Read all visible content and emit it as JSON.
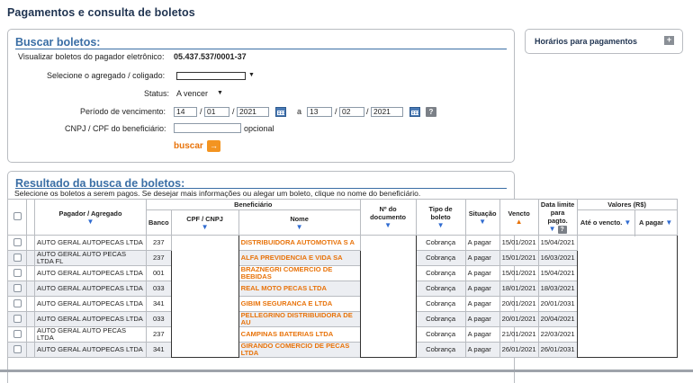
{
  "page": {
    "title": "Pagamentos e consulta de boletos"
  },
  "search": {
    "heading": "Buscar boletos:",
    "payer_label": "Visualizar boletos do pagador eletrônico:",
    "payer_value": "05.437.537/0001-37",
    "aggregate_label": "Selecione o agregado / coligado:",
    "status_label": "Status:",
    "status_value": "A vencer",
    "period_label": "Período de vencimento:",
    "from": {
      "day": "14",
      "month": "01",
      "year": "2021"
    },
    "to_label": "a",
    "to": {
      "day": "13",
      "month": "02",
      "year": "2021"
    },
    "help": "?",
    "cnpj_label": "CNPJ / CPF do beneficiário:",
    "cnpj_value": "",
    "optional_label": "opcional",
    "submit_label": "buscar",
    "submit_icon": "→"
  },
  "side": {
    "title": "Horários para pagamentos",
    "expand": "+"
  },
  "results": {
    "heading": "Resultado da busca de boletos:",
    "instruction": "Selecione os boletos a serem pagos. Se desejar mais informações ou alegar um boleto, clique no nome do beneficiário.",
    "headers": {
      "payer": "Pagador / Agregado",
      "beneficiary": "Beneficiário",
      "bank": "Banco",
      "cpf": "CPF / CNPJ",
      "name": "Nome",
      "doc": "Nº do documento",
      "type": "Tipo de boleto",
      "status": "Situação",
      "due": "Vencto",
      "limit": "Data limite para pagto.",
      "values": "Valores (R$)",
      "until_due": "Até o vencto.",
      "to_pay": "A pagar"
    },
    "rows": [
      {
        "payer": "AUTO GERAL AUTOPECAS LTDA",
        "bank": "237",
        "name": "DISTRIBUIDORA AUTOMOTIVA S A",
        "type": "Cobrança",
        "status": "A pagar",
        "due": "15/01/2021",
        "limit": "15/04/2021"
      },
      {
        "payer": "AUTO GERAL AUTO PECAS LTDA FL",
        "bank": "237",
        "name": "ALFA PREVIDENCIA E VIDA SA",
        "type": "Cobrança",
        "status": "A pagar",
        "due": "15/01/2021",
        "limit": "16/03/2021"
      },
      {
        "payer": "AUTO GERAL AUTOPECAS LTDA",
        "bank": "001",
        "name": "BRAZNEGRI COMERCIO DE BEBIDAS",
        "type": "Cobrança",
        "status": "A pagar",
        "due": "15/01/2021",
        "limit": "15/04/2021"
      },
      {
        "payer": "AUTO GERAL AUTOPECAS LTDA",
        "bank": "033",
        "name": "REAL MOTO PECAS LTDA",
        "type": "Cobrança",
        "status": "A pagar",
        "due": "18/01/2021",
        "limit": "18/03/2021"
      },
      {
        "payer": "AUTO GERAL AUTOPECAS LTDA",
        "bank": "341",
        "name": "GIBIM SEGURANCA E LTDA",
        "type": "Cobrança",
        "status": "A pagar",
        "due": "20/01/2021",
        "limit": "20/01/2031"
      },
      {
        "payer": "AUTO GERAL AUTOPECAS LTDA",
        "bank": "033",
        "name": "PELLEGRINO DISTRIBUIDORA DE AU",
        "type": "Cobrança",
        "status": "A pagar",
        "due": "20/01/2021",
        "limit": "20/04/2021"
      },
      {
        "payer": "AUTO GERAL AUTO PECAS LTDA",
        "bank": "237",
        "name": "CAMPINAS BATERIAS LTDA",
        "type": "Cobrança",
        "status": "A pagar",
        "due": "21/01/2021",
        "limit": "22/03/2021"
      },
      {
        "payer": "AUTO GERAL AUTOPECAS LTDA",
        "bank": "341",
        "name": "GIRANDO COMERCIO DE PECAS LTDA",
        "type": "Cobrança",
        "status": "A pagar",
        "due": "26/01/2021",
        "limit": "26/01/2031"
      }
    ]
  },
  "colors": {
    "accent": "#3a6ea5",
    "orange": "#e8730a",
    "title": "#1f3350"
  },
  "icons": [
    "calendar-icon",
    "help-icon",
    "arrow-right-icon",
    "plus-icon",
    "sort-down-icon",
    "sort-up-icon",
    "checkbox"
  ]
}
